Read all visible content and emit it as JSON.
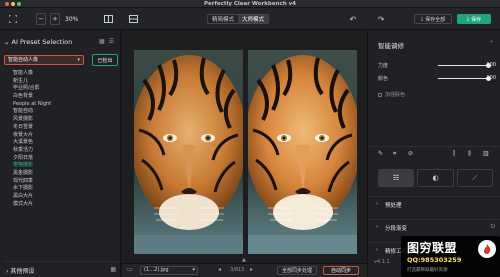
{
  "window": {
    "title": "Perfectly Clear Workbench v4"
  },
  "toolbar": {
    "zoom_minus": "−",
    "zoom_plus": "+",
    "zoom_value": "30%",
    "modes": [
      "精简模式",
      "大师模式"
    ],
    "active_mode_index": 1,
    "save_all_label": "保存全部",
    "save_label": "保存"
  },
  "left_panel": {
    "title": "AI Preset Selection",
    "preset_value": "智能自动人像",
    "apply_label": "已检出",
    "presets": [
      "智能人像",
      "新生儿",
      "毕业照/合影",
      "白色背景",
      "People at Night",
      "智能自动",
      "风景摄影",
      "冬日雪景",
      "夜景大片",
      "大溪景色",
      "秋季活力",
      "夕阳日落",
      "宠物摄影",
      "黑金摄影",
      "现代四季",
      "水下摄影",
      "黑白大片",
      "模式大片"
    ],
    "selected_index": 12,
    "footer_label": "其他预设"
  },
  "center": {
    "file_name": "(1…2).jpg",
    "file_count": "3/815",
    "sync_label": "全部同步处理",
    "auto_label": "自动同步"
  },
  "right_panel": {
    "title": "智能调修",
    "sliders": [
      {
        "label": "力度",
        "value": "100",
        "fraction": 1.0
      },
      {
        "label": "颜色",
        "value": "100",
        "fraction": 1.0
      }
    ],
    "checkbox_label": "加强肤色",
    "sections": [
      "预处理",
      "分段渐变",
      "精修工具"
    ],
    "version": "v4.1.1"
  },
  "watermark": {
    "title": "图穷联盟",
    "qq": "QQ:985303259",
    "subtitle": "打造最稀缺最好资源"
  },
  "colors": {
    "accent_green": "#1fa57a",
    "accent_red": "#d9553c",
    "selected_text": "#2ec08a"
  }
}
